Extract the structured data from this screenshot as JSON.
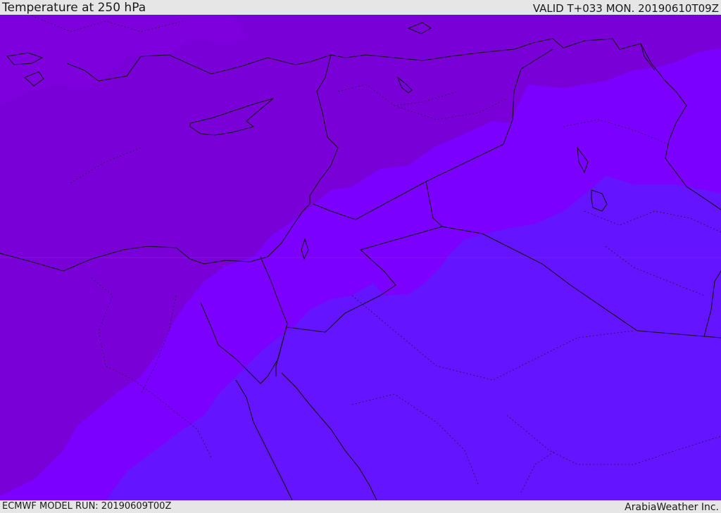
{
  "header": {
    "title": "Temperature at 250 hPa",
    "valid": "VALID T+033 MON. 20190610T09Z"
  },
  "footer": {
    "model_run": "ECMWF MODEL RUN: 20190609T00Z",
    "credit": "ArabiaWeather Inc."
  },
  "colors": {
    "band_coldest": "#7a00d8",
    "band_mid": "#7b00ff",
    "band_warm": "#6414ff",
    "band_north": "#7e06e6",
    "boundary_line": "#111111"
  }
}
